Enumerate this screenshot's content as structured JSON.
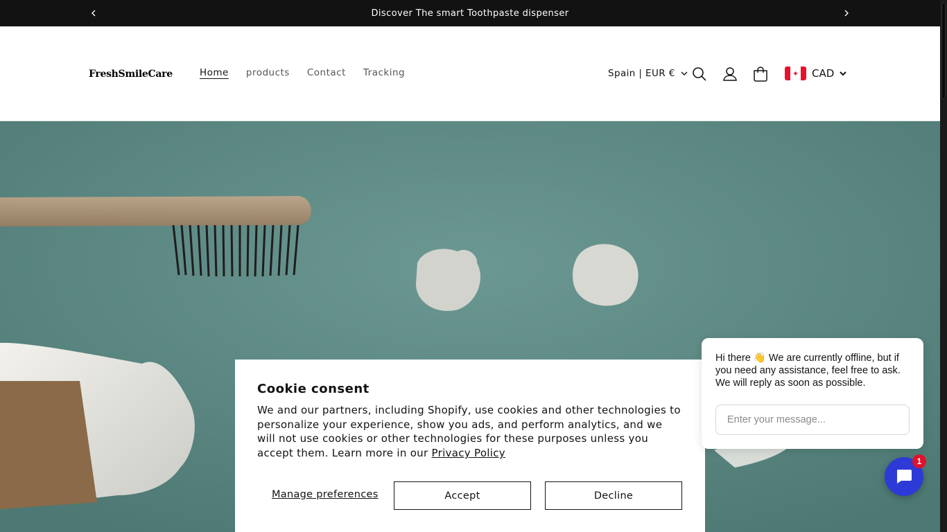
{
  "announcement": {
    "text": "Discover The smart Toothpaste dispenser",
    "prev_icon": "chevron-left-icon",
    "next_icon": "chevron-right-icon"
  },
  "header": {
    "logo": "FreshSmileCare",
    "nav": [
      {
        "label": "Home",
        "active": true
      },
      {
        "label": "products",
        "active": false
      },
      {
        "label": "Contact",
        "active": false
      },
      {
        "label": "Tracking",
        "active": false
      }
    ],
    "locale": "Spain | EUR €",
    "icons": [
      "search-icon",
      "account-icon",
      "cart-icon"
    ],
    "currency": {
      "code": "CAD",
      "flag": "canada-flag-icon"
    }
  },
  "cookie": {
    "title": "Cookie consent",
    "body": "We and our partners, including Shopify, use cookies and other technologies to personalize your experience, show you ads, and perform analytics, and we will not use cookies or other technologies for these purposes unless you accept them. Learn more in our ",
    "link": "Privacy Policy",
    "manage": "Manage preferences",
    "accept": "Accept",
    "decline": "Decline"
  },
  "chat": {
    "message_start": "Hi there",
    "emoji": "👋",
    "message_end": " We are currently offline, but if you need any assistance, feel free to ask. We will reply as soon as possible.",
    "placeholder": "Enter your message...",
    "badge": "1"
  },
  "colors": {
    "announcement_bg": "#121212",
    "hero_bg": "#5e8b86",
    "chat_launcher": "#2d3ad6",
    "badge": "#e0112a"
  }
}
